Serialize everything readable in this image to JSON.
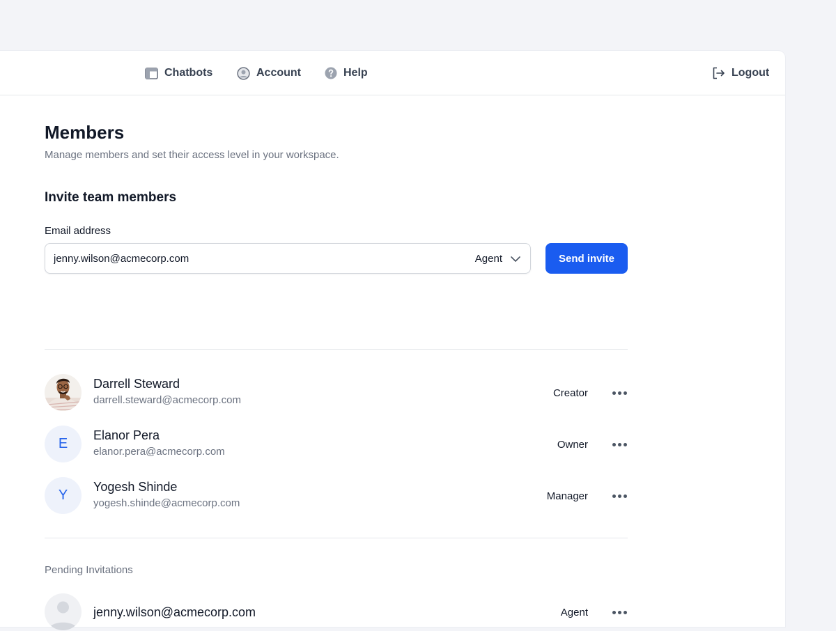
{
  "nav": {
    "items": [
      {
        "label": "Chatbots",
        "icon": "layout-icon"
      },
      {
        "label": "Account",
        "icon": "user-circle-icon"
      },
      {
        "label": "Help",
        "icon": "question-circle-icon"
      }
    ],
    "logout_label": "Logout"
  },
  "page": {
    "title": "Members",
    "subtitle": "Manage members and set their access level in your workspace."
  },
  "invite": {
    "section_title": "Invite team members",
    "email_label": "Email address",
    "email_value": "jenny.wilson@acmecorp.com",
    "role_value": "Agent",
    "send_label": "Send invite"
  },
  "members": [
    {
      "name": "Darrell Steward",
      "email": "darrell.steward@acmecorp.com",
      "role": "Creator",
      "avatar": "photo"
    },
    {
      "name": "Elanor Pera",
      "email": "elanor.pera@acmecorp.com",
      "role": "Owner",
      "avatar": "E"
    },
    {
      "name": "Yogesh Shinde",
      "email": "yogesh.shinde@acmecorp.com",
      "role": "Manager",
      "avatar": "Y"
    }
  ],
  "pending": {
    "title": "Pending Invitations",
    "items": [
      {
        "email": "jenny.wilson@acmecorp.com",
        "role": "Agent",
        "avatar": "placeholder"
      }
    ]
  },
  "colors": {
    "primary": "#1a5cf0",
    "avatar_bg": "#eef2fb",
    "avatar_text": "#2563eb",
    "muted_text": "#6b7280",
    "page_bg": "#f3f4f8"
  }
}
